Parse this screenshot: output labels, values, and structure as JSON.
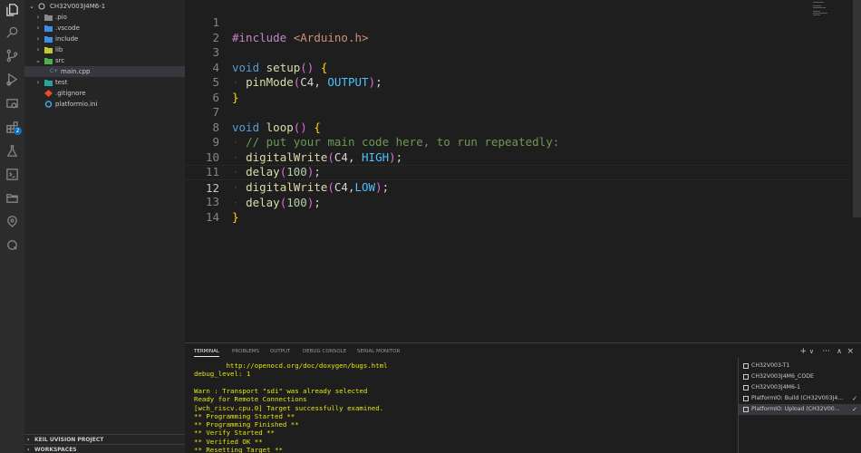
{
  "explorer": {
    "project": "CH32V003J4M6-1",
    "items": [
      {
        "label": ".pio",
        "type": "folder"
      },
      {
        "label": ".vscode",
        "type": "folder"
      },
      {
        "label": "include",
        "type": "folder"
      },
      {
        "label": "lib",
        "type": "folder"
      },
      {
        "label": "src",
        "type": "folder-open"
      },
      {
        "label": "main.cpp",
        "type": "file"
      },
      {
        "label": "test",
        "type": "folder"
      },
      {
        "label": ".gitignore",
        "type": "file"
      },
      {
        "label": "platformio.ini",
        "type": "file"
      }
    ],
    "sections": [
      "KEIL UVISION PROJECT",
      "WORKSPACES"
    ]
  },
  "activity_bar": {
    "icons": [
      "explorer-icon",
      "search-icon",
      "source-control-icon",
      "run-debug-icon",
      "remote-explorer-icon",
      "extensions-icon",
      "testing-icon",
      "terminal-icon",
      "folder-icon",
      "platformio-icon",
      "extension-q-icon"
    ],
    "extensions_badge": "2"
  },
  "editor": {
    "line_numbers": [
      "1",
      "2",
      "3",
      "4",
      "5",
      "6",
      "7",
      "8",
      "9",
      "10",
      "11",
      "12",
      "13",
      "14"
    ],
    "current_line": "12",
    "tokens": {
      "l1_directive": "#include",
      "l1_header": "<Arduino.h>",
      "l3_type": "void",
      "l3_fn": "setup",
      "l4_fn": "pinMode",
      "l4_arg1": "C4",
      "l4_arg2": "OUTPUT",
      "l7_type": "void",
      "l7_fn": "loop",
      "l8_comment": "// put your main code here, to run repeatedly:",
      "l9_fn": "digitalWrite",
      "l9_arg1": "C4",
      "l9_arg2": "HIGH",
      "l10_fn": "delay",
      "l10_arg": "100",
      "l11_fn": "digitalWrite",
      "l11_arg1": "C4",
      "l11_arg2": "LOW",
      "l12_fn": "delay",
      "l12_arg": "100"
    }
  },
  "panel": {
    "tabs": [
      "TERMINAL",
      "PROBLEMS",
      "OUTPUT",
      "DEBUG CONSOLE",
      "SERIAL MONITOR"
    ],
    "actions": [
      "+",
      "∨",
      "···",
      "∧",
      "×"
    ],
    "terminal_lines": [
      "        http://openocd.org/doc/doxygen/bugs.html",
      "debug_level: 1",
      "",
      "Warn : Transport \"sdi\" was already selected",
      "Ready for Remote Connections",
      "[wch_riscv.cpu.0] Target successfully examined.",
      "** Programming Started **",
      "** Programming Finished **",
      "** Verify Started **",
      "** Verified OK **",
      "** Resetting Target **"
    ],
    "terminals": [
      {
        "label": "CH32V003-T1",
        "check": false
      },
      {
        "label": "CH32V003J4M6_CODE",
        "check": false
      },
      {
        "label": "CH32V003J4M6-1",
        "check": false
      },
      {
        "label": "PlatformIO: Build (CH32V003J4...",
        "check": true
      },
      {
        "label": "PlatformIO: Upload (CH32V00...",
        "check": true
      }
    ]
  }
}
